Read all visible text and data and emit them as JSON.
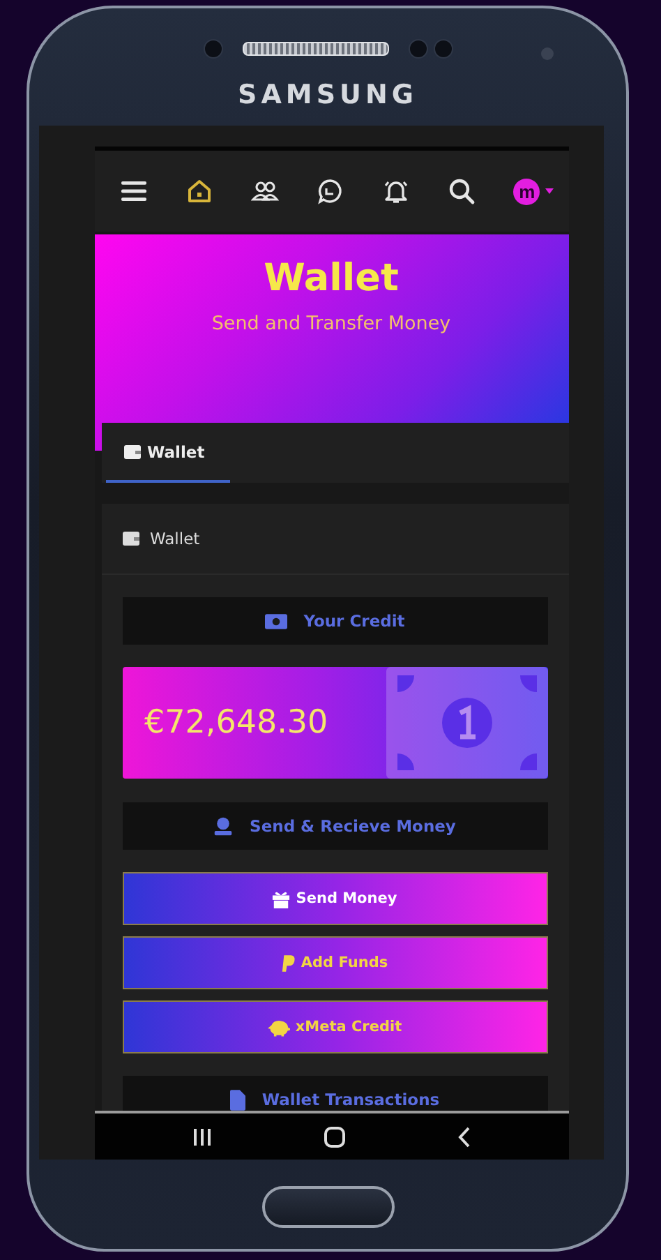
{
  "device": {
    "brand": "SAMSUNG"
  },
  "navbar": {
    "items": [
      {
        "selected": false
      },
      {
        "selected": true
      },
      {
        "selected": false
      },
      {
        "selected": false
      },
      {
        "selected": false
      },
      {
        "selected": false
      }
    ],
    "avatar": "m"
  },
  "hero": {
    "title": "Wallet",
    "subtitle": "Send and Transfer Money"
  },
  "tabs": [
    {
      "label": "Wallet",
      "selected": true
    }
  ],
  "card": {
    "title": "Wallet",
    "sections": [
      {
        "kind": "heading",
        "label": "Your Credit"
      },
      {
        "kind": "balance",
        "amount": "€72,648.30"
      },
      {
        "kind": "heading",
        "label": "Send & Recieve Money"
      },
      {
        "kind": "action",
        "label": "Send Money",
        "color": "#ffffff"
      },
      {
        "kind": "action",
        "label": "Add Funds",
        "color": "#f2d544"
      },
      {
        "kind": "action",
        "label": "xMeta Credit",
        "color": "#f2d544"
      },
      {
        "kind": "heading",
        "label": "Wallet Transactions"
      }
    ]
  }
}
